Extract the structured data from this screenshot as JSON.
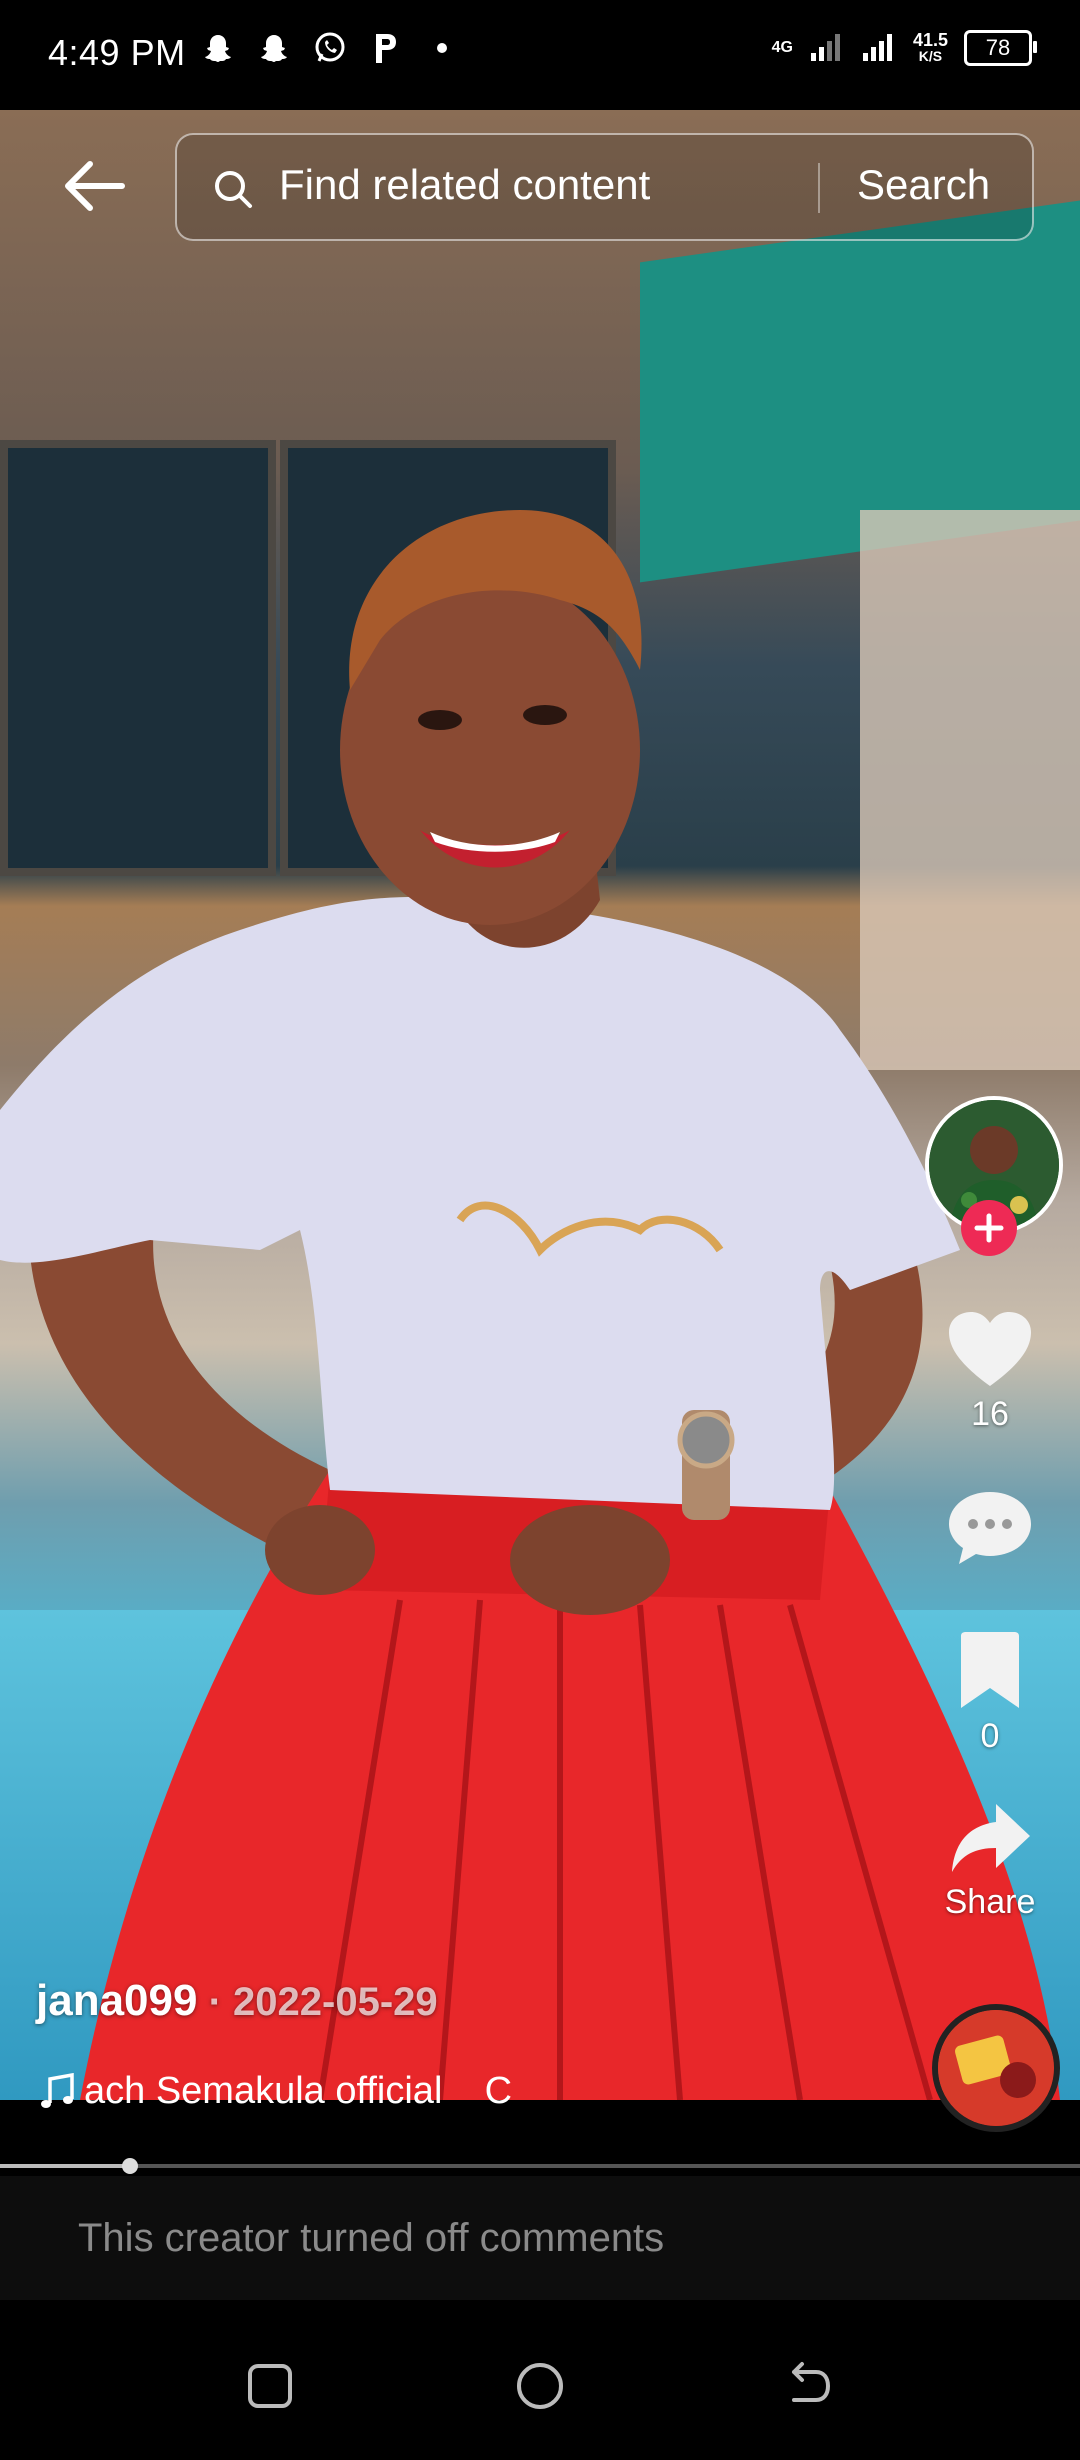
{
  "status_bar": {
    "time": "4:49 PM",
    "notification_icons": [
      "snapchat-icon",
      "snapchat-icon",
      "whatsapp-icon",
      "p-app-icon",
      "dot-icon"
    ],
    "network_label": "4G",
    "speed_value": "41.5",
    "speed_unit": "K/S",
    "battery": "78"
  },
  "search": {
    "placeholder": "Find related content",
    "button_label": "Search"
  },
  "actions": {
    "likes": "16",
    "saves": "0",
    "share_label": "Share"
  },
  "caption": {
    "username": "jana099",
    "date": " · 2022-05-29",
    "music": "ach Semakula official    C"
  },
  "progress": {
    "fraction": 0.12
  },
  "comments": {
    "notice": "This creator turned off comments"
  },
  "colors": {
    "accent": "#ee2a55",
    "background": "#000000"
  }
}
